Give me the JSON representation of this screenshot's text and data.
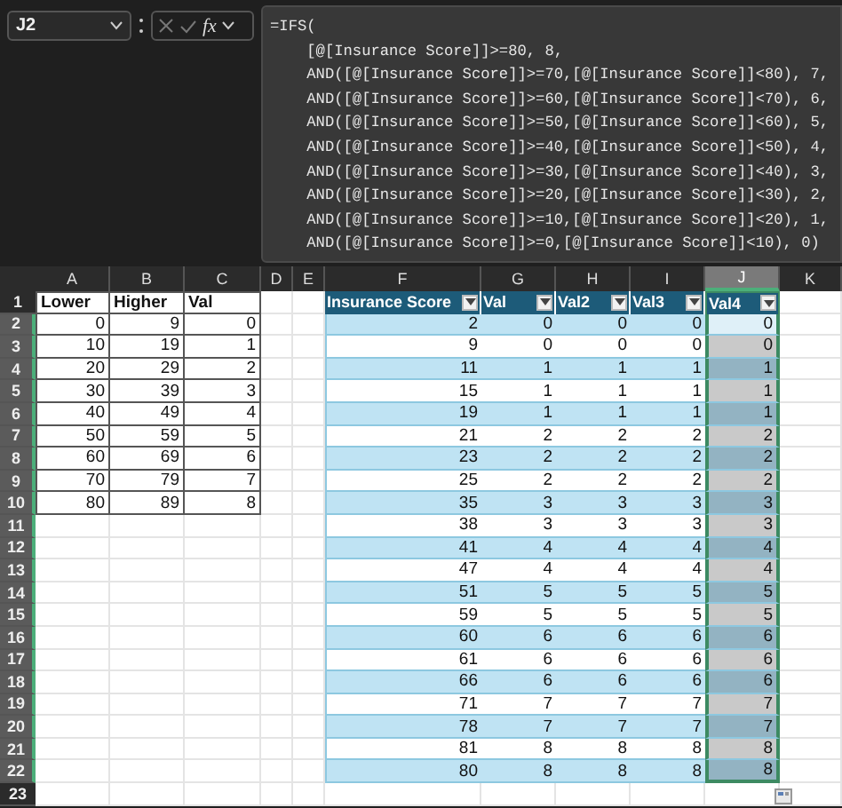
{
  "formula_bar": {
    "name_box": "J2",
    "function_label": "fx",
    "formula_lines": [
      "=IFS(",
      "    [@[Insurance Score]]>=80, 8,",
      "    AND([@[Insurance Score]]>=70,[@[Insurance Score]]<80), 7,",
      "    AND([@[Insurance Score]]>=60,[@[Insurance Score]]<70), 6,",
      "    AND([@[Insurance Score]]>=50,[@[Insurance Score]]<60), 5,",
      "    AND([@[Insurance Score]]>=40,[@[Insurance Score]]<50), 4,",
      "    AND([@[Insurance Score]]>=30,[@[Insurance Score]]<40), 3,",
      "    AND([@[Insurance Score]]>=20,[@[Insurance Score]]<30), 2,",
      "    AND([@[Insurance Score]]>=10,[@[Insurance Score]]<20), 1,",
      "    AND([@[Insurance Score]]>=0,[@[Insurance Score]]<10), 0)"
    ]
  },
  "grid": {
    "columns": [
      {
        "label": "A",
        "selected": false
      },
      {
        "label": "B",
        "selected": false
      },
      {
        "label": "C",
        "selected": false
      },
      {
        "label": "D",
        "selected": false
      },
      {
        "label": "E",
        "selected": false
      },
      {
        "label": "F",
        "selected": false
      },
      {
        "label": "G",
        "selected": false
      },
      {
        "label": "H",
        "selected": false
      },
      {
        "label": "I",
        "selected": false
      },
      {
        "label": "J",
        "selected": true
      },
      {
        "label": "K",
        "selected": false
      }
    ],
    "rows": [
      {
        "label": "1",
        "selected": false
      },
      {
        "label": "2",
        "selected": true
      },
      {
        "label": "3",
        "selected": true
      },
      {
        "label": "4",
        "selected": true
      },
      {
        "label": "5",
        "selected": true
      },
      {
        "label": "6",
        "selected": true
      },
      {
        "label": "7",
        "selected": true
      },
      {
        "label": "8",
        "selected": true
      },
      {
        "label": "9",
        "selected": true
      },
      {
        "label": "10",
        "selected": true
      },
      {
        "label": "11",
        "selected": true
      },
      {
        "label": "12",
        "selected": true
      },
      {
        "label": "13",
        "selected": true
      },
      {
        "label": "14",
        "selected": true
      },
      {
        "label": "15",
        "selected": true
      },
      {
        "label": "16",
        "selected": true
      },
      {
        "label": "17",
        "selected": true
      },
      {
        "label": "18",
        "selected": true
      },
      {
        "label": "19",
        "selected": true
      },
      {
        "label": "20",
        "selected": true
      },
      {
        "label": "21",
        "selected": true
      },
      {
        "label": "22",
        "selected": true
      },
      {
        "label": "23",
        "selected": false
      }
    ]
  },
  "lookup_table": {
    "columns": [
      "Lower",
      "Higher",
      "Val"
    ],
    "rows": [
      [
        "0",
        "9",
        "0"
      ],
      [
        "10",
        "19",
        "1"
      ],
      [
        "20",
        "29",
        "2"
      ],
      [
        "30",
        "39",
        "3"
      ],
      [
        "40",
        "49",
        "4"
      ],
      [
        "50",
        "59",
        "5"
      ],
      [
        "60",
        "69",
        "6"
      ],
      [
        "70",
        "79",
        "7"
      ],
      [
        "80",
        "89",
        "8"
      ]
    ]
  },
  "insurance_table": {
    "columns": [
      {
        "label": "Insurance Score",
        "selected": false
      },
      {
        "label": "Val",
        "selected": false
      },
      {
        "label": "Val2",
        "selected": false
      },
      {
        "label": "Val3",
        "selected": false
      },
      {
        "label": "Val4",
        "selected": true
      }
    ],
    "rows": [
      {
        "cells": [
          "2",
          "0",
          "0",
          "0",
          "0"
        ],
        "active": true
      },
      {
        "cells": [
          "9",
          "0",
          "0",
          "0",
          "0"
        ],
        "active": false
      },
      {
        "cells": [
          "11",
          "1",
          "1",
          "1",
          "1"
        ],
        "active": false
      },
      {
        "cells": [
          "15",
          "1",
          "1",
          "1",
          "1"
        ],
        "active": false
      },
      {
        "cells": [
          "19",
          "1",
          "1",
          "1",
          "1"
        ],
        "active": false
      },
      {
        "cells": [
          "21",
          "2",
          "2",
          "2",
          "2"
        ],
        "active": false
      },
      {
        "cells": [
          "23",
          "2",
          "2",
          "2",
          "2"
        ],
        "active": false
      },
      {
        "cells": [
          "25",
          "2",
          "2",
          "2",
          "2"
        ],
        "active": false
      },
      {
        "cells": [
          "35",
          "3",
          "3",
          "3",
          "3"
        ],
        "active": false
      },
      {
        "cells": [
          "38",
          "3",
          "3",
          "3",
          "3"
        ],
        "active": false
      },
      {
        "cells": [
          "41",
          "4",
          "4",
          "4",
          "4"
        ],
        "active": false
      },
      {
        "cells": [
          "47",
          "4",
          "4",
          "4",
          "4"
        ],
        "active": false
      },
      {
        "cells": [
          "51",
          "5",
          "5",
          "5",
          "5"
        ],
        "active": false
      },
      {
        "cells": [
          "59",
          "5",
          "5",
          "5",
          "5"
        ],
        "active": false
      },
      {
        "cells": [
          "60",
          "6",
          "6",
          "6",
          "6"
        ],
        "active": false
      },
      {
        "cells": [
          "61",
          "6",
          "6",
          "6",
          "6"
        ],
        "active": false
      },
      {
        "cells": [
          "66",
          "6",
          "6",
          "6",
          "6"
        ],
        "active": false
      },
      {
        "cells": [
          "71",
          "7",
          "7",
          "7",
          "7"
        ],
        "active": false
      },
      {
        "cells": [
          "78",
          "7",
          "7",
          "7",
          "7"
        ],
        "active": false
      },
      {
        "cells": [
          "81",
          "8",
          "8",
          "8",
          "8"
        ],
        "active": false
      },
      {
        "cells": [
          "80",
          "8",
          "8",
          "8",
          "8"
        ],
        "active": false
      }
    ]
  }
}
